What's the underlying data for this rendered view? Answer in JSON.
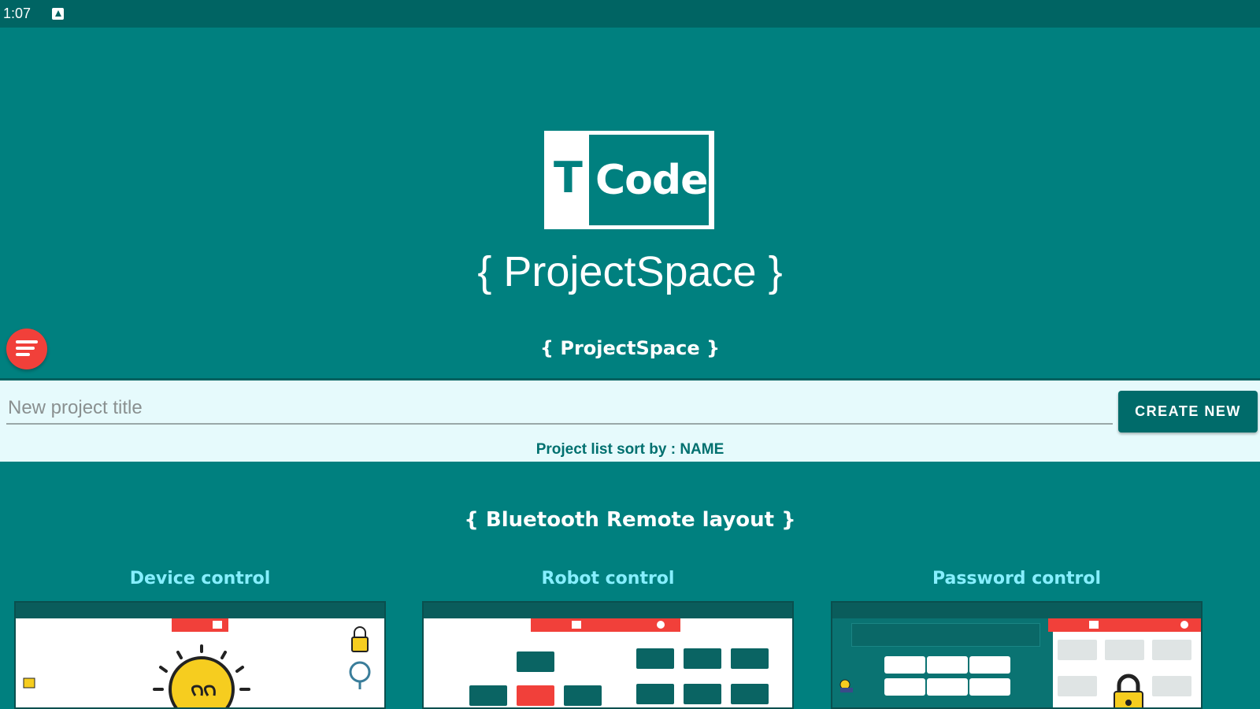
{
  "status_bar": {
    "time": "1:07",
    "notification_icon": "notification-a-icon"
  },
  "logo": {
    "t_letter": "T",
    "code_text": "Code"
  },
  "headline": "{ ProjectSpace }",
  "menu_icon": "menu-lines-icon",
  "section_project": "{ ProjectSpace }",
  "project_input": {
    "placeholder": "New project title",
    "value": ""
  },
  "create_button": "CREATE NEW",
  "sort_label": "Project list sort by : NAME",
  "section_layout": "{ Bluetooth Remote layout }",
  "cards": [
    {
      "title": "Device control"
    },
    {
      "title": "Robot control"
    },
    {
      "title": "Password control"
    }
  ],
  "colors": {
    "background": "#00807f",
    "status_bar": "#006463",
    "accent_red": "#f1403a",
    "card_title": "#86efff",
    "input_panel": "#e6fafc",
    "button": "#006b6a"
  }
}
